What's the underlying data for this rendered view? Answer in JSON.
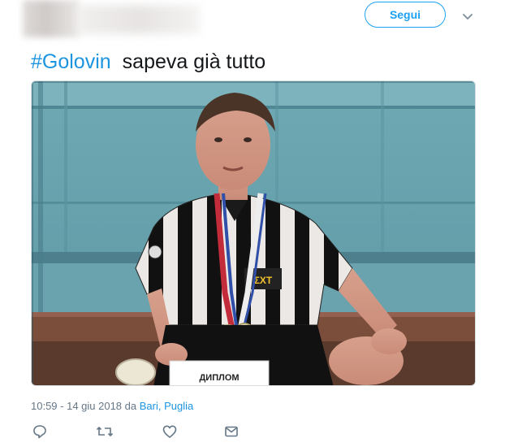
{
  "header": {
    "follow_label": "Segui",
    "menu_icon": "chevron-down-icon"
  },
  "tweet": {
    "hashtag": "#Golovin",
    "text": "sapeva già tutto",
    "photo": {
      "diploma_text": "ДИПЛОМ",
      "sponsor_text": "ΣΧΤ"
    },
    "time": "10:59 - 14 giu 2018",
    "from_label": "da",
    "location": "Bari, Puglia"
  },
  "actions": {
    "reply_icon": "reply-icon",
    "retweet_icon": "retweet-icon",
    "like_icon": "heart-icon",
    "dm_icon": "envelope-icon"
  },
  "colors": {
    "accent": "#1da1f2",
    "link": "#1b95e0",
    "muted": "#657786"
  }
}
